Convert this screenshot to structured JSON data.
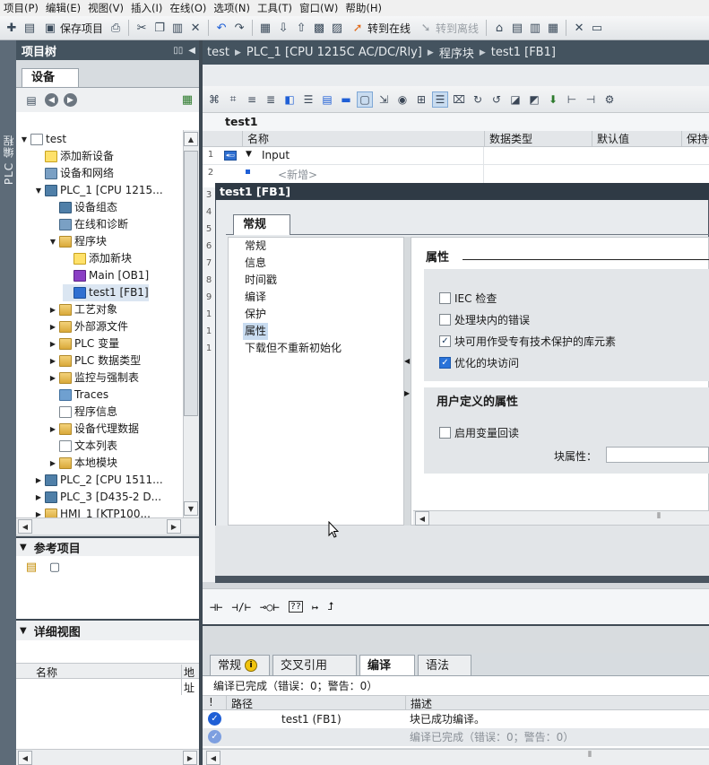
{
  "menu": [
    "项目(P)",
    "编辑(E)",
    "视图(V)",
    "插入(I)",
    "在线(O)",
    "选项(N)",
    "工具(T)",
    "窗口(W)",
    "帮助(H)"
  ],
  "toolbar": {
    "save_project": "保存项目",
    "go_online": "转到在线",
    "go_offline": "转到离线"
  },
  "left_strip_label": "PLC 编程",
  "project_tree": {
    "title": "项目树",
    "tab": "设备",
    "items": [
      {
        "label": "test",
        "indent": 0,
        "toggle": "expanded",
        "icon": "doc"
      },
      {
        "label": "添加新设备",
        "indent": 1,
        "toggle": "none",
        "icon": "star"
      },
      {
        "label": "设备和网络",
        "indent": 1,
        "toggle": "none",
        "icon": "net"
      },
      {
        "label": "PLC_1 [CPU 1215...",
        "indent": 1,
        "toggle": "expanded",
        "icon": "cpu"
      },
      {
        "label": "设备组态",
        "indent": 2,
        "toggle": "none",
        "icon": "cpu"
      },
      {
        "label": "在线和诊断",
        "indent": 2,
        "toggle": "none",
        "icon": "net"
      },
      {
        "label": "程序块",
        "indent": 2,
        "toggle": "expanded",
        "icon": "folder"
      },
      {
        "label": "添加新块",
        "indent": 3,
        "toggle": "none",
        "icon": "star"
      },
      {
        "label": "Main [OB1]",
        "indent": 3,
        "toggle": "none",
        "icon": "purple"
      },
      {
        "label": "test1 [FB1]",
        "indent": 3,
        "toggle": "none",
        "icon": "blue",
        "selected": true
      },
      {
        "label": "工艺对象",
        "indent": 2,
        "toggle": "collapsed",
        "icon": "folder"
      },
      {
        "label": "外部源文件",
        "indent": 2,
        "toggle": "collapsed",
        "icon": "folder"
      },
      {
        "label": "PLC 变量",
        "indent": 2,
        "toggle": "collapsed",
        "icon": "folder"
      },
      {
        "label": "PLC 数据类型",
        "indent": 2,
        "toggle": "collapsed",
        "icon": "folder"
      },
      {
        "label": "监控与强制表",
        "indent": 2,
        "toggle": "collapsed",
        "icon": "folder"
      },
      {
        "label": "Traces",
        "indent": 2,
        "toggle": "none",
        "icon": "trace"
      },
      {
        "label": "程序信息",
        "indent": 2,
        "toggle": "none",
        "icon": "doc"
      },
      {
        "label": "设备代理数据",
        "indent": 2,
        "toggle": "collapsed",
        "icon": "folder"
      },
      {
        "label": "文本列表",
        "indent": 2,
        "toggle": "none",
        "icon": "doc"
      },
      {
        "label": "本地模块",
        "indent": 2,
        "toggle": "collapsed",
        "icon": "folder"
      },
      {
        "label": "PLC_2 [CPU 1511...",
        "indent": 1,
        "toggle": "collapsed",
        "icon": "cpu"
      },
      {
        "label": "PLC_3 [D435-2 D...",
        "indent": 1,
        "toggle": "collapsed",
        "icon": "cpu"
      },
      {
        "label": "HMI_1 [KTP100...",
        "indent": 1,
        "toggle": "collapsed",
        "icon": "folder"
      }
    ]
  },
  "reference_projects": {
    "title": "参考项目"
  },
  "details_view": {
    "title": "详细视图",
    "col_name": "名称",
    "col_address": "地址"
  },
  "breadcrumb": [
    "test",
    "PLC_1 [CPU 1215C AC/DC/Rly]",
    "程序块",
    "test1 [FB1]"
  ],
  "editor": {
    "block_title": "test1",
    "columns": [
      "名称",
      "数据类型",
      "默认值",
      "保持性"
    ],
    "rows": [
      {
        "line": "1",
        "name": "Input"
      },
      {
        "line": "2",
        "name": "<新增>"
      }
    ],
    "line_numbers": [
      "3",
      "4",
      "5",
      "6",
      "7",
      "8",
      "9",
      "1",
      "1",
      "1"
    ]
  },
  "dialog": {
    "title": "test1 [FB1]",
    "tab": "常规",
    "nav": [
      "常规",
      "信息",
      "时间戳",
      "编译",
      "保护",
      "属性",
      "下载但不重新初始化"
    ],
    "active_nav": "属性",
    "section_attributes": "属性",
    "checkboxes": [
      {
        "label": "IEC 检查",
        "checked": false
      },
      {
        "label": "处理块内的错误",
        "checked": false
      },
      {
        "label": "块可用作受专有技术保护的库元素",
        "checked": true
      },
      {
        "label": "优化的块访问",
        "checked": true
      }
    ],
    "section_user_defined": "用户定义的属性",
    "enable_readback": {
      "label": "启用变量回读",
      "checked": false
    },
    "block_attribute_label": "块属性：",
    "block_attribute_value": ""
  },
  "ladder_toolbar": [
    "⊣⊢",
    "⊣/⊢",
    "⊸○⊢",
    "??",
    "↦",
    "⮥"
  ],
  "inspector": {
    "tabs": [
      "常规",
      "交叉引用",
      "编译",
      "语法"
    ],
    "active_tab": "编译",
    "status": "编译已完成（错误：0；警告：0）",
    "columns": [
      "!",
      "路径",
      "描述"
    ],
    "messages": [
      {
        "path": "test1 (FB1)",
        "description": "块已成功编译。"
      },
      {
        "path": "",
        "description": "编译已完成（错误：0；警告：0）"
      }
    ]
  },
  "colors": {
    "title_bar": "#44535f",
    "accent": "#2a73d9",
    "dialog_title": "#2f3a45"
  }
}
